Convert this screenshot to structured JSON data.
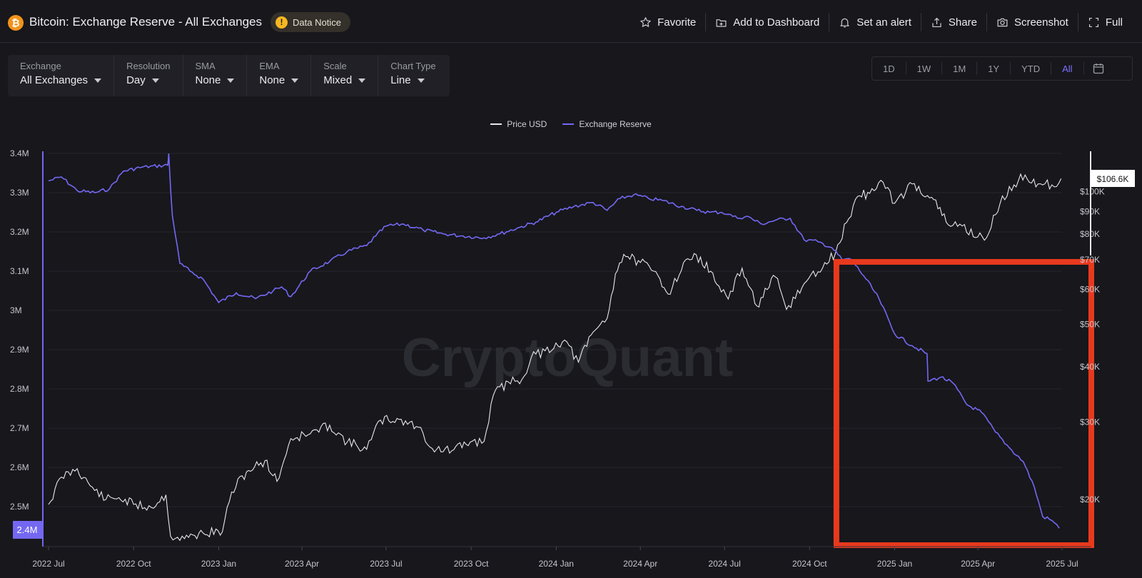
{
  "header": {
    "logo_symbol": "₿",
    "title": "Bitcoin: Exchange Reserve - All Exchanges",
    "notice_label": "Data Notice",
    "notice_icon": "!",
    "actions": [
      {
        "label": "Favorite",
        "icon": "star-icon"
      },
      {
        "label": "Add to Dashboard",
        "icon": "add-dashboard-icon"
      },
      {
        "label": "Set an alert",
        "icon": "bell-icon"
      },
      {
        "label": "Share",
        "icon": "share-icon"
      },
      {
        "label": "Screenshot",
        "icon": "camera-icon"
      },
      {
        "label": "Full",
        "icon": "fullscreen-icon"
      }
    ]
  },
  "controls": [
    {
      "label": "Exchange",
      "value": "All Exchanges"
    },
    {
      "label": "Resolution",
      "value": "Day"
    },
    {
      "label": "SMA",
      "value": "None"
    },
    {
      "label": "EMA",
      "value": "None"
    },
    {
      "label": "Scale",
      "value": "Mixed"
    },
    {
      "label": "Chart Type",
      "value": "Line"
    }
  ],
  "ranges": {
    "options": [
      "1D",
      "1W",
      "1M",
      "1Y",
      "YTD",
      "All"
    ],
    "selected": "All",
    "calendar_icon": "calendar-icon"
  },
  "colors": {
    "background": "#17171c",
    "reserve_line": "#7468f2",
    "price_line": "#e8e8ec",
    "highlight_box": "#e8391d",
    "grid": "#26262d"
  },
  "watermark": "CryptoQuant",
  "chart_data": {
    "type": "line",
    "legend": [
      "Price USD",
      "Exchange Reserve"
    ],
    "legend_position": "top-center",
    "grid": true,
    "x_ticks": [
      "2022 Jul",
      "2022 Oct",
      "2023 Jan",
      "2023 Apr",
      "2023 Jul",
      "2023 Oct",
      "2024 Jan",
      "2024 Apr",
      "2024 Jul",
      "2024 Oct",
      "2025 Jan",
      "2025 Apr",
      "2025 Jul"
    ],
    "xlim": [
      "2022-07-01",
      "2025-07-01"
    ],
    "left_axis": {
      "label": "",
      "ticks": [
        "3.4M",
        "3.3M",
        "3.2M",
        "3.1M",
        "3M",
        "2.9M",
        "2.8M",
        "2.7M",
        "2.6M",
        "2.5M"
      ],
      "tick_values": [
        3400000,
        3300000,
        3200000,
        3100000,
        3000000,
        2900000,
        2800000,
        2700000,
        2600000,
        2500000
      ],
      "ylim": [
        2400000,
        3400000
      ],
      "current_value_label": "2.4M"
    },
    "right_axis": {
      "label": "",
      "scale": "log",
      "ticks": [
        "$100K",
        "$90K",
        "$80K",
        "$70K",
        "$60K",
        "$50K",
        "$40K",
        "$30K",
        "$20K"
      ],
      "tick_values": [
        100000,
        90000,
        80000,
        70000,
        60000,
        50000,
        40000,
        30000,
        20000
      ],
      "ylim": [
        15700,
        122000
      ],
      "current_value_label": "$106.6K"
    },
    "series": [
      {
        "name": "Exchange Reserve",
        "axis": "left",
        "x": [
          "2022-07-01",
          "2022-07-15",
          "2022-08-01",
          "2022-08-20",
          "2022-09-05",
          "2022-09-20",
          "2022-10-10",
          "2022-11-07",
          "2022-11-08",
          "2022-11-10",
          "2022-11-12",
          "2022-11-20",
          "2022-12-01",
          "2022-12-15",
          "2023-01-01",
          "2023-01-20",
          "2023-02-10",
          "2023-03-01",
          "2023-03-10",
          "2023-03-20",
          "2023-04-10",
          "2023-05-01",
          "2023-05-20",
          "2023-06-10",
          "2023-06-20",
          "2023-07-01",
          "2023-07-20",
          "2023-08-10",
          "2023-09-01",
          "2023-09-20",
          "2023-10-15",
          "2023-11-01",
          "2023-11-20",
          "2023-12-10",
          "2024-01-01",
          "2024-01-20",
          "2024-02-10",
          "2024-02-25",
          "2024-03-10",
          "2024-03-25",
          "2024-04-10",
          "2024-04-25",
          "2024-05-15",
          "2024-06-01",
          "2024-06-15",
          "2024-06-28",
          "2024-07-05",
          "2024-07-15",
          "2024-07-25",
          "2024-08-10",
          "2024-08-25",
          "2024-09-10",
          "2024-09-25",
          "2024-10-10",
          "2024-10-25",
          "2024-11-05",
          "2024-11-15",
          "2024-12-01",
          "2024-12-15",
          "2025-01-01",
          "2025-01-20",
          "2025-02-05",
          "2025-02-06",
          "2025-02-20",
          "2025-03-05",
          "2025-03-20",
          "2025-04-05",
          "2025-04-20",
          "2025-05-05",
          "2025-05-20",
          "2025-06-01",
          "2025-06-10",
          "2025-06-20",
          "2025-06-28"
        ],
        "values": [
          3330000,
          3340000,
          3305000,
          3300000,
          3310000,
          3355000,
          3365000,
          3370000,
          3400000,
          3310000,
          3240000,
          3120000,
          3100000,
          3080000,
          3020000,
          3045000,
          3030000,
          3050000,
          3060000,
          3035000,
          3100000,
          3125000,
          3150000,
          3165000,
          3190000,
          3215000,
          3220000,
          3205000,
          3195000,
          3190000,
          3185000,
          3195000,
          3210000,
          3225000,
          3250000,
          3265000,
          3275000,
          3255000,
          3285000,
          3295000,
          3285000,
          3280000,
          3265000,
          3255000,
          3250000,
          3250000,
          3245000,
          3235000,
          3240000,
          3220000,
          3230000,
          3235000,
          3180000,
          3175000,
          3160000,
          3130000,
          3130000,
          3080000,
          3030000,
          2940000,
          2910000,
          2890000,
          2820000,
          2830000,
          2815000,
          2760000,
          2740000,
          2690000,
          2650000,
          2615000,
          2550000,
          2475000,
          2465000,
          2445000
        ]
      },
      {
        "name": "Price USD",
        "axis": "right",
        "x": [
          "2022-07-01",
          "2022-07-15",
          "2022-08-01",
          "2022-08-15",
          "2022-09-01",
          "2022-09-15",
          "2022-10-01",
          "2022-10-20",
          "2022-11-05",
          "2022-11-10",
          "2022-11-25",
          "2022-12-15",
          "2023-01-05",
          "2023-01-15",
          "2023-01-31",
          "2023-02-20",
          "2023-03-05",
          "2023-03-20",
          "2023-04-10",
          "2023-05-01",
          "2023-05-20",
          "2023-06-10",
          "2023-06-25",
          "2023-07-15",
          "2023-08-05",
          "2023-08-20",
          "2023-09-10",
          "2023-09-30",
          "2023-10-15",
          "2023-10-25",
          "2023-11-10",
          "2023-11-25",
          "2023-12-05",
          "2023-12-20",
          "2024-01-10",
          "2024-01-25",
          "2024-02-10",
          "2024-02-25",
          "2024-03-05",
          "2024-03-14",
          "2024-04-01",
          "2024-04-20",
          "2024-05-01",
          "2024-05-20",
          "2024-06-05",
          "2024-06-25",
          "2024-07-05",
          "2024-07-20",
          "2024-08-05",
          "2024-08-25",
          "2024-09-06",
          "2024-09-30",
          "2024-10-15",
          "2024-10-29",
          "2024-11-10",
          "2024-11-22",
          "2024-12-05",
          "2024-12-17",
          "2025-01-01",
          "2025-01-20",
          "2025-02-10",
          "2025-02-28",
          "2025-03-15",
          "2025-04-08",
          "2025-04-25",
          "2025-05-10",
          "2025-05-22",
          "2025-06-05",
          "2025-06-20",
          "2025-06-30"
        ],
        "values": [
          19500,
          22500,
          23500,
          21500,
          20000,
          20200,
          19500,
          19200,
          20500,
          16500,
          16300,
          16800,
          16900,
          20800,
          23100,
          24500,
          22000,
          27500,
          28200,
          29500,
          27000,
          26000,
          30300,
          30400,
          29200,
          26100,
          25800,
          27000,
          27100,
          34500,
          37000,
          37500,
          42000,
          43500,
          46000,
          41000,
          48000,
          51500,
          65000,
          72000,
          69000,
          64500,
          58500,
          70000,
          71000,
          61000,
          57000,
          67000,
          55000,
          64000,
          54000,
          63500,
          67000,
          72500,
          85000,
          97500,
          99000,
          106000,
          94000,
          104000,
          97000,
          84000,
          83500,
          77500,
          94000,
          103500,
          109000,
          104000,
          103500,
          107000
        ]
      }
    ],
    "highlight_region": {
      "x_start": "2024-10-30",
      "x_end": "2025-07-01"
    }
  }
}
